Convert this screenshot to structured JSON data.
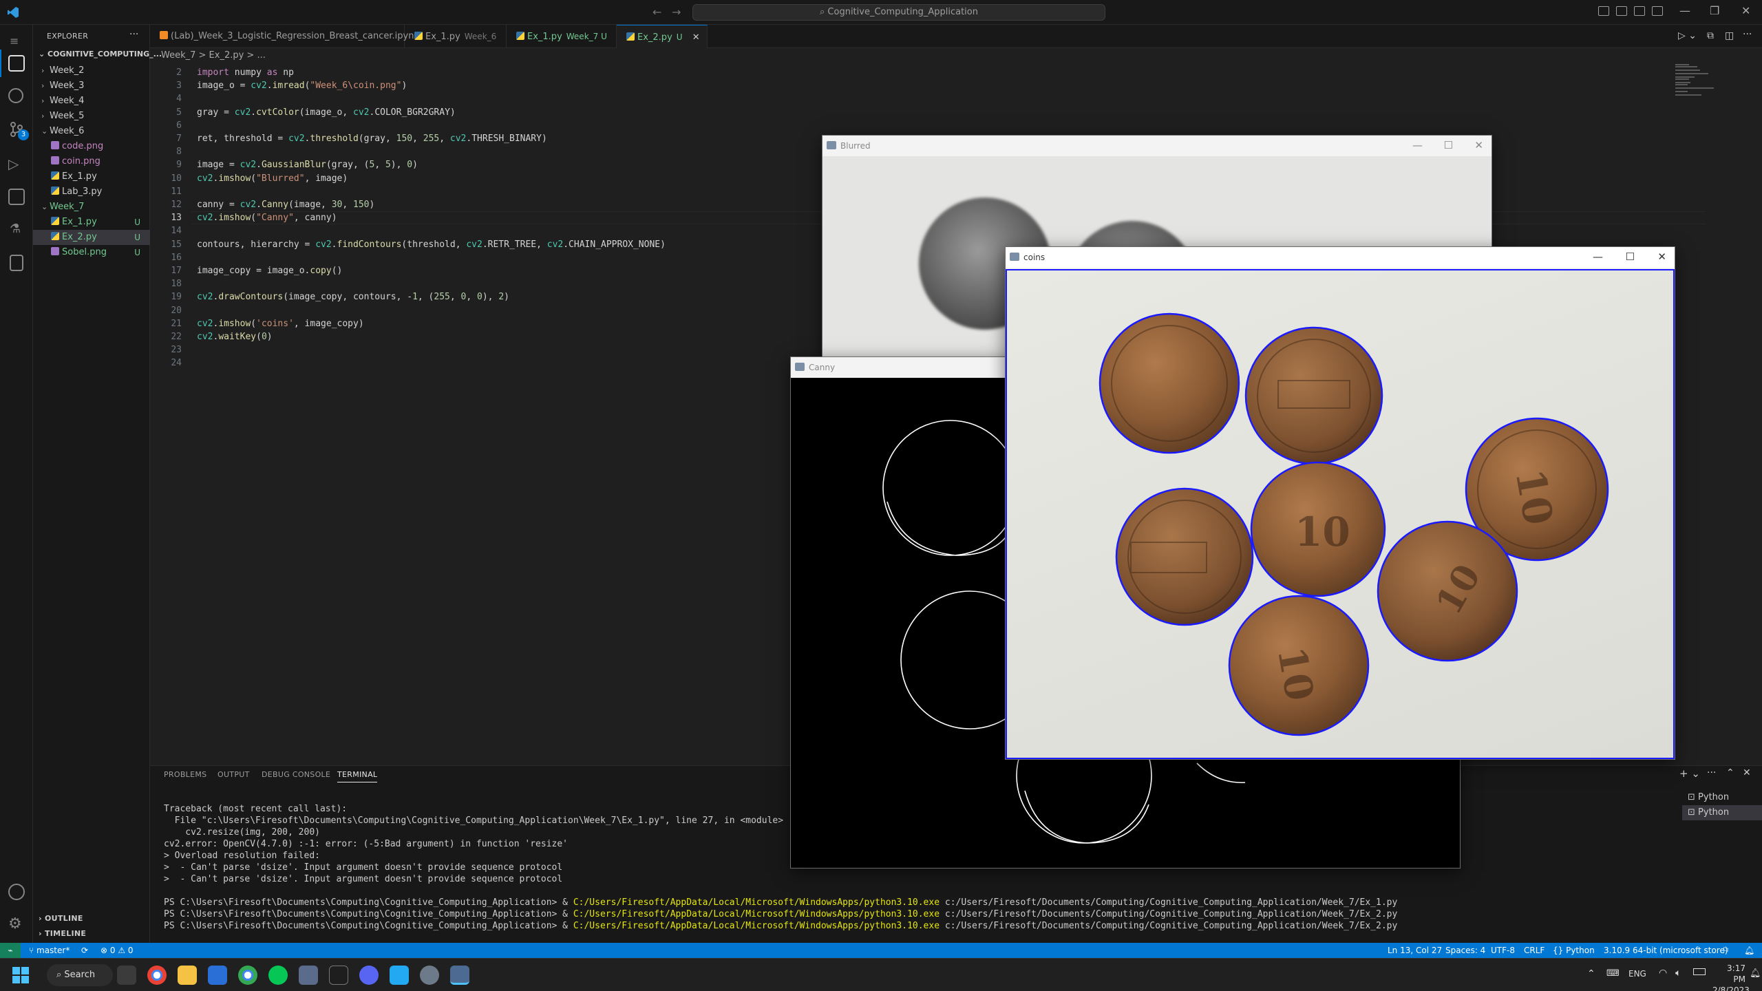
{
  "titlebar": {
    "search": "Cognitive_Computing_Application"
  },
  "activity": {
    "scm_badge": "3"
  },
  "explorer": {
    "title": "EXPLORER",
    "project": "COGNITIVE_COMPUTING_...",
    "items": [
      {
        "label": "Week_2",
        "kind": "folder",
        "open": false
      },
      {
        "label": "Week_3",
        "kind": "folder",
        "open": false
      },
      {
        "label": "Week_4",
        "kind": "folder",
        "open": false
      },
      {
        "label": "Week_5",
        "kind": "folder",
        "open": false
      },
      {
        "label": "Week_6",
        "kind": "folder",
        "open": true
      },
      {
        "label": "code.png",
        "kind": "image"
      },
      {
        "label": "coin.png",
        "kind": "image"
      },
      {
        "label": "Ex_1.py",
        "kind": "py"
      },
      {
        "label": "Lab_3.py",
        "kind": "py"
      },
      {
        "label": "Week_7",
        "kind": "folder",
        "open": true
      },
      {
        "label": "Ex_1.py",
        "kind": "py",
        "status": "U"
      },
      {
        "label": "Ex_2.py",
        "kind": "py",
        "status": "U"
      },
      {
        "label": "Sobel.png",
        "kind": "image",
        "status": "U"
      }
    ],
    "outline": "OUTLINE",
    "timeline": "TIMELINE"
  },
  "tabs": [
    {
      "label": "(Lab)_Week_3_Logistic_Regression_Breast_cancer.ipynb",
      "sub": ""
    },
    {
      "label": "Ex_1.py",
      "sub": "Week_6"
    },
    {
      "label": "Ex_1.py",
      "sub": "Week_7 U"
    },
    {
      "label": "Ex_2.py",
      "sub": "U"
    }
  ],
  "breadcrumb": "Week_7 >  Ex_2.py > ...",
  "code": {
    "current_line": "13",
    "lines": [
      {
        "n": "2",
        "t": "import numpy as np"
      },
      {
        "n": "3",
        "t": "image_o = cv2.imread(\"Week_6\\coin.png\")"
      },
      {
        "n": "4",
        "t": ""
      },
      {
        "n": "5",
        "t": "gray = cv2.cvtColor(image_o, cv2.COLOR_BGR2GRAY)"
      },
      {
        "n": "6",
        "t": ""
      },
      {
        "n": "7",
        "t": "ret, threshold = cv2.threshold(gray, 150, 255, cv2.THRESH_BINARY)"
      },
      {
        "n": "8",
        "t": ""
      },
      {
        "n": "9",
        "t": "image = cv2.GaussianBlur(gray, (5, 5), 0)"
      },
      {
        "n": "10",
        "t": "cv2.imshow(\"Blurred\", image)"
      },
      {
        "n": "11",
        "t": ""
      },
      {
        "n": "12",
        "t": "canny = cv2.Canny(image, 30, 150)"
      },
      {
        "n": "13",
        "t": "cv2.imshow(\"Canny\", canny)"
      },
      {
        "n": "14",
        "t": ""
      },
      {
        "n": "15",
        "t": "contours, hierarchy = cv2.findContours(threshold, cv2.RETR_TREE, cv2.CHAIN_APPROX_NONE)"
      },
      {
        "n": "16",
        "t": ""
      },
      {
        "n": "17",
        "t": "image_copy = image_o.copy()"
      },
      {
        "n": "18",
        "t": ""
      },
      {
        "n": "19",
        "t": "cv2.drawContours(image_copy, contours, -1, (255, 0, 0), 2)"
      },
      {
        "n": "20",
        "t": ""
      },
      {
        "n": "21",
        "t": "cv2.imshow('coins', image_copy)"
      },
      {
        "n": "22",
        "t": "cv2.waitKey(0)"
      },
      {
        "n": "23",
        "t": ""
      },
      {
        "n": "24",
        "t": ""
      }
    ]
  },
  "panel": {
    "tabs": [
      "PROBLEMS",
      "OUTPUT",
      "DEBUG CONSOLE",
      "TERMINAL"
    ],
    "active_tab": "TERMINAL",
    "terminal_lines": [
      "Traceback (most recent call last):",
      "  File \"c:\\Users\\Firesoft\\Documents\\Computing\\Cognitive_Computing_Application\\Week_7\\Ex_1.py\", line 27, in <module>",
      "    cv2.resize(img, 200, 200)",
      "cv2.error: OpenCV(4.7.0) :-1: error: (-5:Bad argument) in function 'resize'",
      "> Overload resolution failed:",
      ">  - Can't parse 'dsize'. Input argument doesn't provide sequence protocol",
      ">  - Can't parse 'dsize'. Input argument doesn't provide sequence protocol"
    ],
    "ps_lines": [
      {
        "prompt": "PS C:\\Users\\Firesoft\\Documents\\Computing\\Cognitive_Computing_Application> & ",
        "exe": "C:/Users/Firesoft/AppData/Local/Microsoft/WindowsApps/python3.10.exe",
        "arg": " c:/Users/Firesoft/Documents/Computing/Cognitive_Computing_Application/Week_7/Ex_1.py"
      },
      {
        "prompt": "PS C:\\Users\\Firesoft\\Documents\\Computing\\Cognitive_Computing_Application> & ",
        "exe": "C:/Users/Firesoft/AppData/Local/Microsoft/WindowsApps/python3.10.exe",
        "arg": " c:/Users/Firesoft/Documents/Computing/Cognitive_Computing_Application/Week_7/Ex_2.py"
      },
      {
        "prompt": "PS C:\\Users\\Firesoft\\Documents\\Computing\\Cognitive_Computing_Application> & ",
        "exe": "C:/Users/Firesoft/AppData/Local/Microsoft/WindowsApps/python3.10.exe",
        "arg": " c:/Users/Firesoft/Documents/Computing/Cognitive_Computing_Application/Week_7/Ex_2.py"
      }
    ],
    "terminals": [
      "Python",
      "Python"
    ]
  },
  "statusbar": {
    "branch": "master*",
    "problems": "⊗ 0 ⚠ 0",
    "position": "Ln 13, Col 27",
    "spaces": "Spaces: 4",
    "encoding": "UTF-8",
    "eol": "CRLF",
    "language": "Python",
    "interpreter": "3.10.9 64-bit (microsoft store)"
  },
  "windows": {
    "blurred": "Blurred",
    "canny": "Canny",
    "coins": "coins"
  },
  "taskbar": {
    "search": "Search",
    "lang": "ENG",
    "time": "3:17 PM",
    "date": "2/8/2023"
  },
  "colors": {
    "accent": "#0078d4",
    "contour": "#1a1aff",
    "untracked": "#73c991"
  }
}
